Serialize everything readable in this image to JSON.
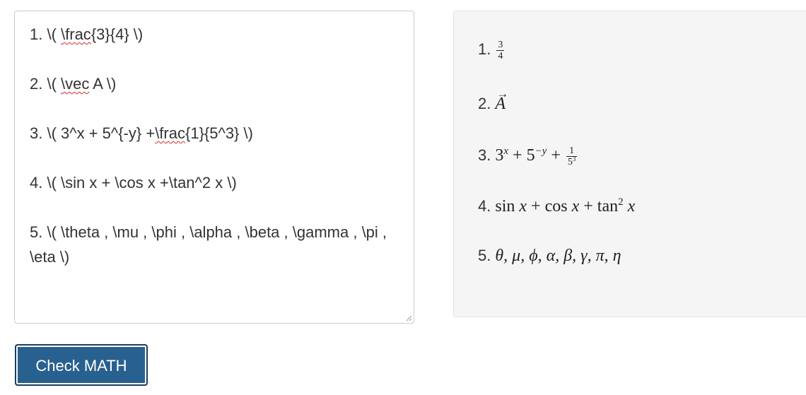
{
  "editor": {
    "lines": [
      {
        "before": "1. \\( ",
        "marked": "\\frac",
        "after": "{3}{4} \\)"
      },
      {
        "before": "2. \\( ",
        "marked": "\\vec",
        "after": " A \\)"
      },
      {
        "before": "3. \\( 3^x + 5^{-y} +",
        "marked": "\\frac",
        "after": "{1}{5^3} \\)"
      },
      {
        "before": "4. \\( \\sin x + \\cos x +\\tan^2 x \\)",
        "marked": "",
        "after": ""
      },
      {
        "before": "5. \\( \\theta , \\mu , \\phi , \\alpha , \\beta , \\gamma , \\pi , \\eta \\)",
        "marked": "",
        "after": ""
      }
    ]
  },
  "preview": {
    "items": [
      {
        "num": "1.",
        "frac_num": "3",
        "frac_den": "4"
      },
      {
        "num": "2.",
        "var": "A",
        "arrow": "→"
      },
      {
        "num": "3.",
        "base1": "3",
        "exp1": "x",
        "op1": "+",
        "base2": "5",
        "exp2": "−y",
        "op2": "+",
        "frac_num": "1",
        "frac_den_base": "5",
        "frac_den_exp": "3"
      },
      {
        "num": "4.",
        "sin": "sin",
        "x1": "x",
        "plus1": "+",
        "cos": "cos",
        "x2": "x",
        "plus2": "+",
        "tan": "tan",
        "exp": "2",
        "x3": "x"
      },
      {
        "num": "5.",
        "greek": "θ, μ, ϕ, α, β, γ, π, η"
      }
    ]
  },
  "actions": {
    "check_label": "Check MATH"
  }
}
